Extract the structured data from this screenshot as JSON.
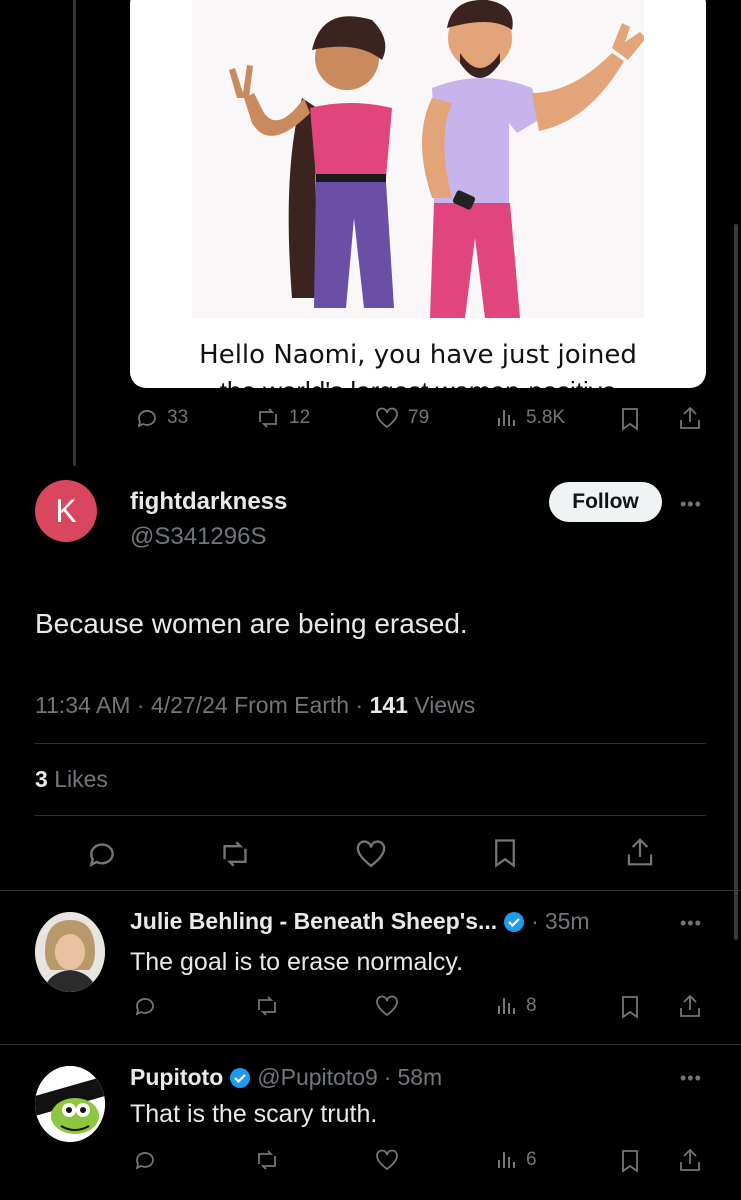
{
  "media_post": {
    "caption_line1": "Hello Naomi, you have just joined",
    "caption_line2": "the world's largest women-positive",
    "actions": {
      "replies": "33",
      "reposts": "12",
      "likes": "79",
      "views": "5.8K"
    }
  },
  "main_tweet": {
    "avatar_letter": "K",
    "display_name": "fightdarkness",
    "handle": "@S341296S",
    "follow_label": "Follow",
    "text": "Because women are being erased.",
    "time": "11:34 AM",
    "date": "4/27/24",
    "source": "From Earth",
    "views_count": "141",
    "views_label": "Views",
    "likes_count": "3",
    "likes_label": "Likes"
  },
  "replies": [
    {
      "display_name": "Julie Behling - Beneath Sheep's...",
      "verified": true,
      "handle": "",
      "time": "35m",
      "text": "The goal is to erase normalcy.",
      "views": "8"
    },
    {
      "display_name": "Pupitoto",
      "verified": true,
      "handle": "@Pupitoto9",
      "time": "58m",
      "text": "That is the scary truth.",
      "views": "6"
    }
  ],
  "colors": {
    "accent": "#1d9bf0",
    "avatar_bg": "#d9475e",
    "muted": "#71767b"
  }
}
